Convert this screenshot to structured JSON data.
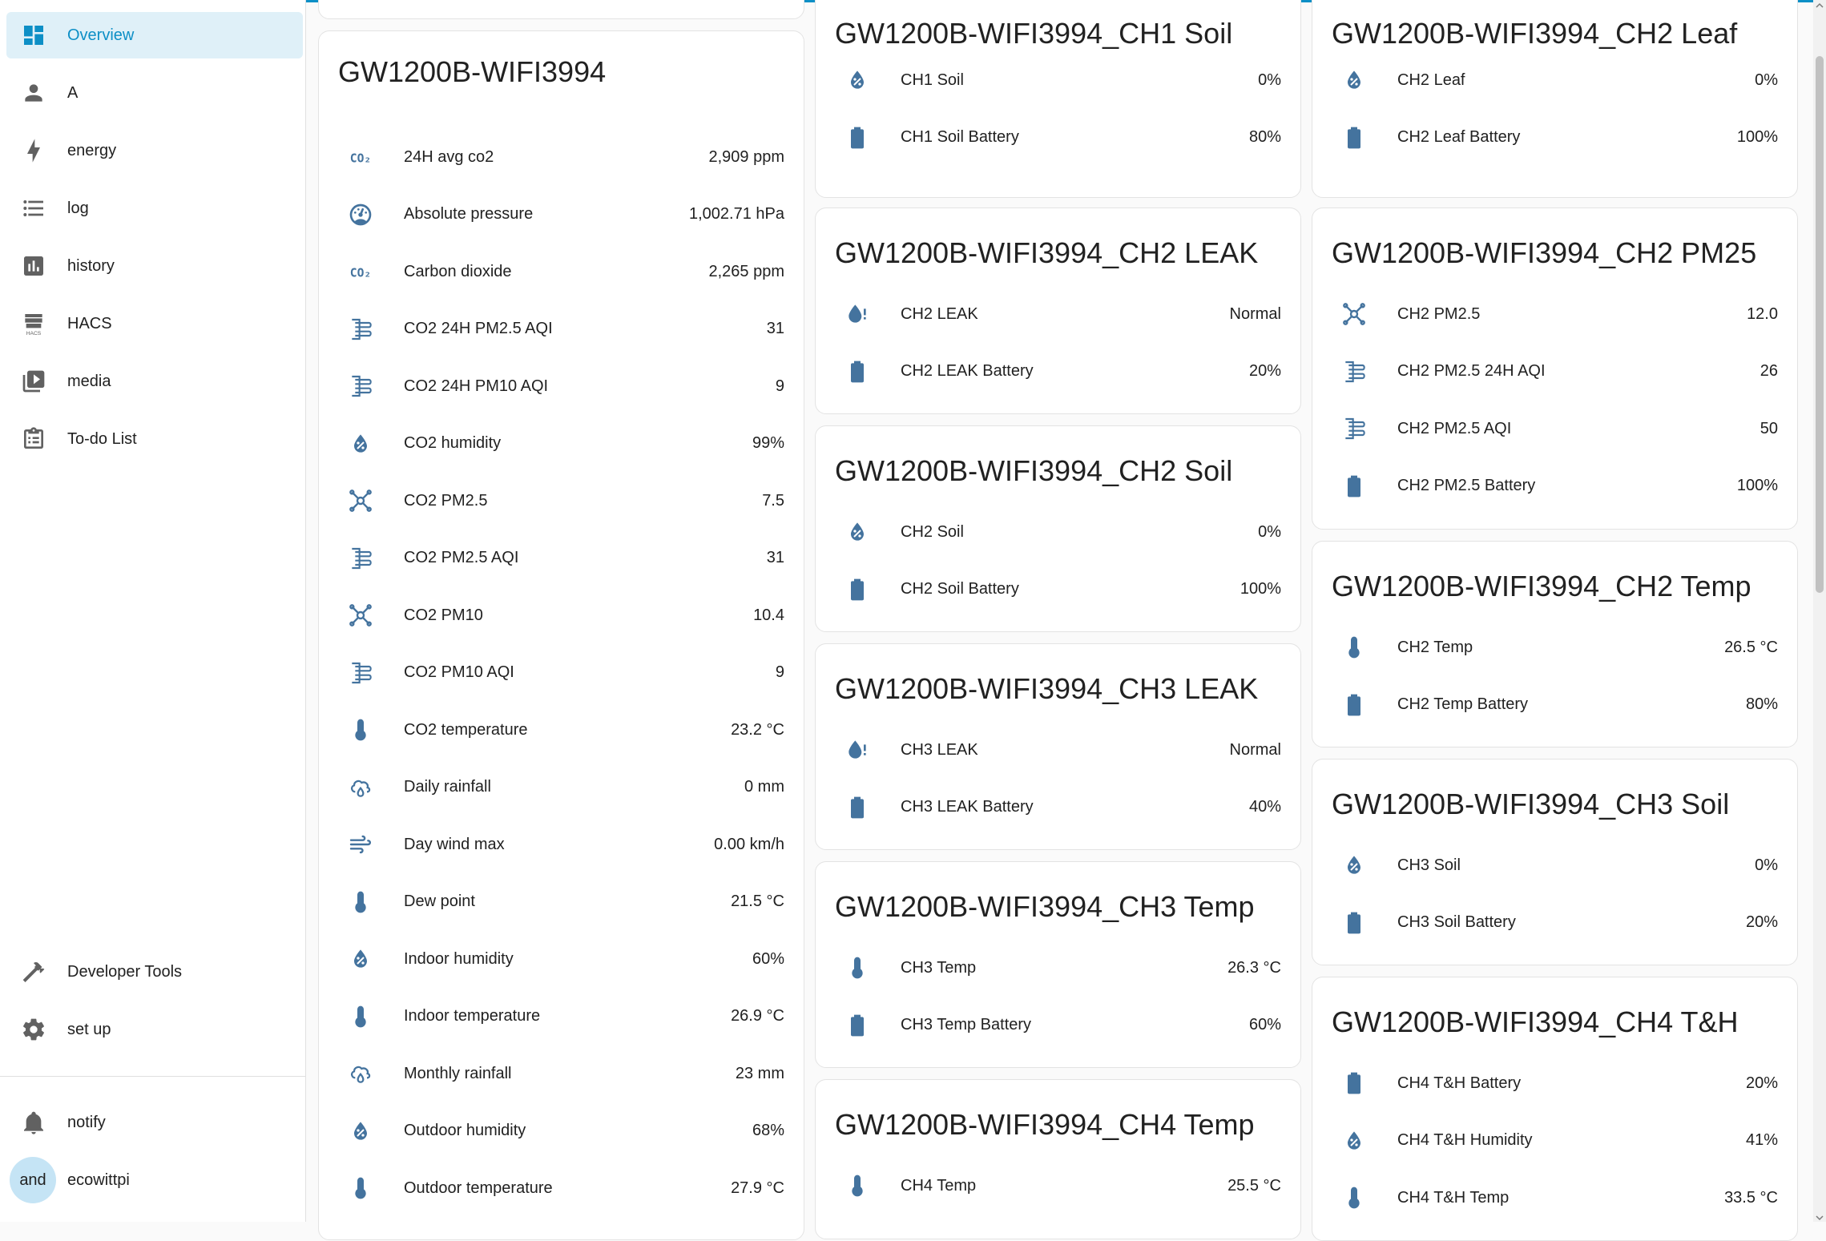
{
  "sidebar": {
    "items": [
      {
        "label": "Overview",
        "icon": "dashboard-icon",
        "active": true
      },
      {
        "label": "A",
        "icon": "account-icon"
      },
      {
        "label": "energy",
        "icon": "lightning-icon"
      },
      {
        "label": "log",
        "icon": "format-list-icon"
      },
      {
        "label": "history",
        "icon": "chart-box-icon"
      },
      {
        "label": "HACS",
        "icon": "hacs-icon",
        "icon_text": "HACS"
      },
      {
        "label": "media",
        "icon": "play-box-icon"
      },
      {
        "label": "To-do List",
        "icon": "clipboard-list-icon"
      }
    ],
    "bottom_items": [
      {
        "label": "Developer Tools",
        "icon": "hammer-icon"
      },
      {
        "label": "set up",
        "icon": "gear-icon"
      }
    ],
    "notify": {
      "label": "notify",
      "icon": "bell-icon"
    },
    "user": {
      "avatar": "and",
      "name": "ecowittpi"
    }
  },
  "cards": {
    "main": {
      "title": "GW1200B-WIFI3994",
      "rows": [
        {
          "icon": "co2-icon",
          "label": "24H avg co2",
          "value": "2,909 ppm"
        },
        {
          "icon": "gauge-icon",
          "label": "Absolute pressure",
          "value": "1,002.71 hPa"
        },
        {
          "icon": "co2-icon",
          "label": "Carbon dioxide",
          "value": "2,265 ppm"
        },
        {
          "icon": "air-filter-icon",
          "label": "CO2 24H PM2.5 AQI",
          "value": "31"
        },
        {
          "icon": "air-filter-icon",
          "label": "CO2 24H PM10 AQI",
          "value": "9"
        },
        {
          "icon": "water-percent-icon",
          "label": "CO2 humidity",
          "value": "99%"
        },
        {
          "icon": "molecule-icon",
          "label": "CO2 PM2.5",
          "value": "7.5"
        },
        {
          "icon": "air-filter-icon",
          "label": "CO2 PM2.5 AQI",
          "value": "31"
        },
        {
          "icon": "molecule-icon",
          "label": "CO2 PM10",
          "value": "10.4"
        },
        {
          "icon": "air-filter-icon",
          "label": "CO2 PM10 AQI",
          "value": "9"
        },
        {
          "icon": "thermometer-icon",
          "label": "CO2 temperature",
          "value": "23.2 °C"
        },
        {
          "icon": "rain-cloud-icon",
          "label": "Daily rainfall",
          "value": "0 mm"
        },
        {
          "icon": "wind-icon",
          "label": "Day wind max",
          "value": "0.00 km/h"
        },
        {
          "icon": "thermometer-icon",
          "label": "Dew point",
          "value": "21.5 °C"
        },
        {
          "icon": "water-percent-icon",
          "label": "Indoor humidity",
          "value": "60%"
        },
        {
          "icon": "thermometer-icon",
          "label": "Indoor temperature",
          "value": "26.9 °C"
        },
        {
          "icon": "rain-cloud-icon",
          "label": "Monthly rainfall",
          "value": "23 mm"
        },
        {
          "icon": "water-percent-icon",
          "label": "Outdoor humidity",
          "value": "68%"
        },
        {
          "icon": "thermometer-icon",
          "label": "Outdoor temperature",
          "value": "27.9 °C"
        }
      ]
    },
    "col2": [
      {
        "title": "GW1200B-WIFI3994_CH1 Soil",
        "rows": [
          {
            "icon": "water-percent-icon",
            "label": "CH1 Soil",
            "value": "0%"
          },
          {
            "icon": "battery-icon",
            "label": "CH1 Soil Battery",
            "value": "80%"
          }
        ]
      },
      {
        "title": "GW1200B-WIFI3994_CH2 LEAK",
        "rows": [
          {
            "icon": "water-alert-icon",
            "label": "CH2 LEAK",
            "value": "Normal"
          },
          {
            "icon": "battery-icon",
            "label": "CH2 LEAK Battery",
            "value": "20%"
          }
        ]
      },
      {
        "title": "GW1200B-WIFI3994_CH2 Soil",
        "rows": [
          {
            "icon": "water-percent-icon",
            "label": "CH2 Soil",
            "value": "0%"
          },
          {
            "icon": "battery-icon",
            "label": "CH2 Soil Battery",
            "value": "100%"
          }
        ]
      },
      {
        "title": "GW1200B-WIFI3994_CH3 LEAK",
        "rows": [
          {
            "icon": "water-alert-icon",
            "label": "CH3 LEAK",
            "value": "Normal"
          },
          {
            "icon": "battery-icon",
            "label": "CH3 LEAK Battery",
            "value": "40%"
          }
        ]
      },
      {
        "title": "GW1200B-WIFI3994_CH3 Temp",
        "rows": [
          {
            "icon": "thermometer-icon",
            "label": "CH3 Temp",
            "value": "26.3 °C"
          },
          {
            "icon": "battery-icon",
            "label": "CH3 Temp Battery",
            "value": "60%"
          }
        ]
      },
      {
        "title": "GW1200B-WIFI3994_CH4 Temp",
        "rows": [
          {
            "icon": "thermometer-icon",
            "label": "CH4 Temp",
            "value": "25.5 °C"
          }
        ]
      }
    ],
    "col3": [
      {
        "title": "GW1200B-WIFI3994_CH2 Leaf",
        "rows": [
          {
            "icon": "water-percent-icon",
            "label": "CH2 Leaf",
            "value": "0%"
          },
          {
            "icon": "battery-icon",
            "label": "CH2 Leaf Battery",
            "value": "100%"
          }
        ]
      },
      {
        "title": "GW1200B-WIFI3994_CH2 PM25",
        "rows": [
          {
            "icon": "molecule-icon",
            "label": "CH2 PM2.5",
            "value": "12.0"
          },
          {
            "icon": "air-filter-icon",
            "label": "CH2 PM2.5 24H AQI",
            "value": "26"
          },
          {
            "icon": "air-filter-icon",
            "label": "CH2 PM2.5 AQI",
            "value": "50"
          },
          {
            "icon": "battery-icon",
            "label": "CH2 PM2.5 Battery",
            "value": "100%"
          }
        ]
      },
      {
        "title": "GW1200B-WIFI3994_CH2 Temp",
        "rows": [
          {
            "icon": "thermometer-icon",
            "label": "CH2 Temp",
            "value": "26.5 °C"
          },
          {
            "icon": "battery-icon",
            "label": "CH2 Temp Battery",
            "value": "80%"
          }
        ]
      },
      {
        "title": "GW1200B-WIFI3994_CH3 Soil",
        "rows": [
          {
            "icon": "water-percent-icon",
            "label": "CH3 Soil",
            "value": "0%"
          },
          {
            "icon": "battery-icon",
            "label": "CH3 Soil Battery",
            "value": "20%"
          }
        ]
      },
      {
        "title": "GW1200B-WIFI3994_CH4 T&H",
        "rows": [
          {
            "icon": "battery-icon",
            "label": "CH4 T&H Battery",
            "value": "20%"
          },
          {
            "icon": "water-percent-icon",
            "label": "CH4 T&H Humidity",
            "value": "41%"
          },
          {
            "icon": "thermometer-icon",
            "label": "CH4 T&H Temp",
            "value": "33.5 °C"
          }
        ]
      }
    ]
  },
  "colors": {
    "accent": "#0d8fc6",
    "icon": "#44739e",
    "active_bg": "#dff0f8"
  }
}
